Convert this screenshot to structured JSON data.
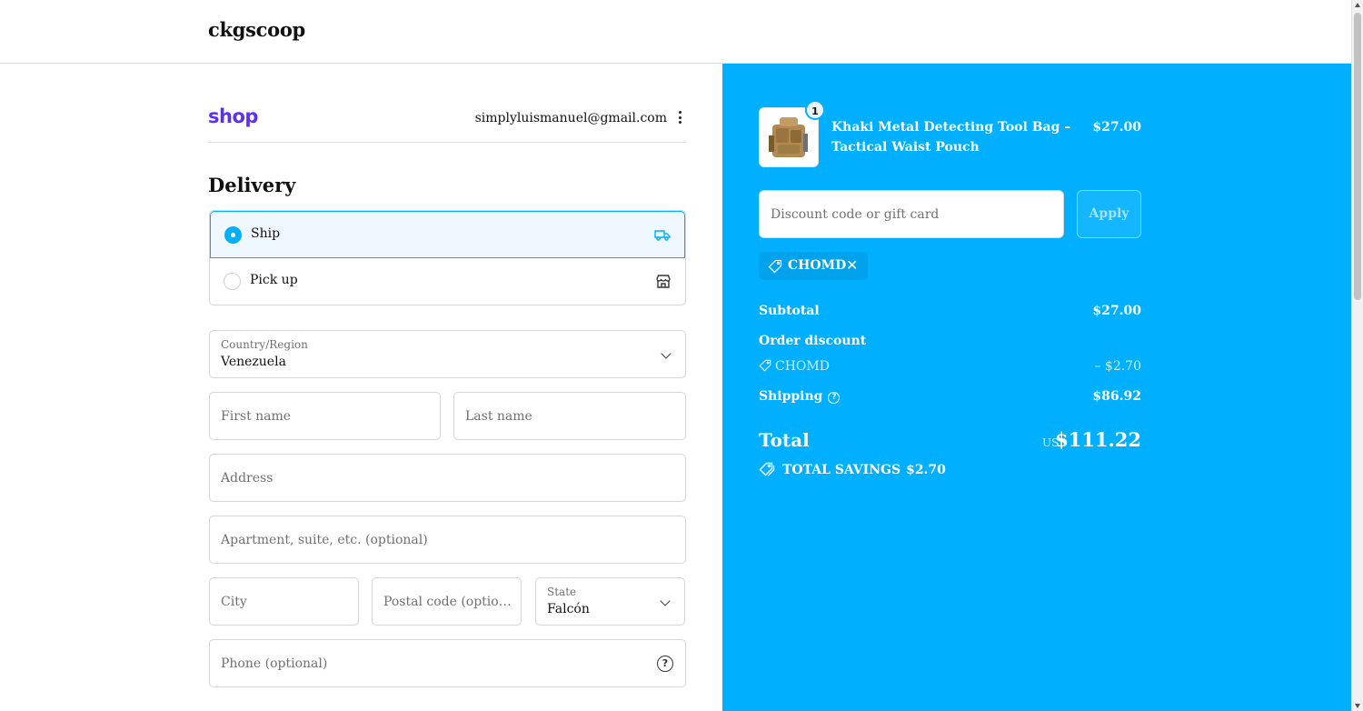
{
  "header": {
    "store_name": "ckgscoop"
  },
  "account": {
    "shop_logo": "shop",
    "email": "simplyluismanuel@gmail.com"
  },
  "delivery": {
    "title": "Delivery",
    "methods": [
      {
        "label": "Ship",
        "selected": true,
        "icon": "truck-icon"
      },
      {
        "label": "Pick up",
        "selected": false,
        "icon": "store-icon"
      }
    ]
  },
  "form": {
    "country": {
      "label": "Country/Region",
      "value": "Venezuela"
    },
    "first_name": {
      "placeholder": "First name"
    },
    "last_name": {
      "placeholder": "Last name"
    },
    "address": {
      "placeholder": "Address"
    },
    "apartment": {
      "placeholder": "Apartment, suite, etc. (optional)"
    },
    "city": {
      "placeholder": "City"
    },
    "postal_code": {
      "placeholder": "Postal code (option..."
    },
    "state": {
      "label": "State",
      "value": "Falcón"
    },
    "phone": {
      "placeholder": "Phone (optional)"
    }
  },
  "order": {
    "product": {
      "name": "Khaki Metal Detecting Tool Bag – Tactical Waist Pouch",
      "price": "$27.00",
      "quantity": "1"
    },
    "discount_input": {
      "placeholder": "Discount code or gift card"
    },
    "apply_label": "Apply",
    "applied_code": "CHOMD",
    "subtotal": {
      "label": "Subtotal",
      "value": "$27.00"
    },
    "order_discount": {
      "label": "Order discount",
      "code": "CHOMD",
      "value": "– $2.70"
    },
    "shipping": {
      "label": "Shipping",
      "value": "$86.92"
    },
    "total": {
      "label": "Total",
      "currency": "USD",
      "value": "$111.22"
    },
    "savings": {
      "label": "TOTAL SAVINGS",
      "value": "$2.70"
    }
  },
  "colors": {
    "accent": "#00b0ff",
    "shop_brand": "#5a31f4"
  }
}
